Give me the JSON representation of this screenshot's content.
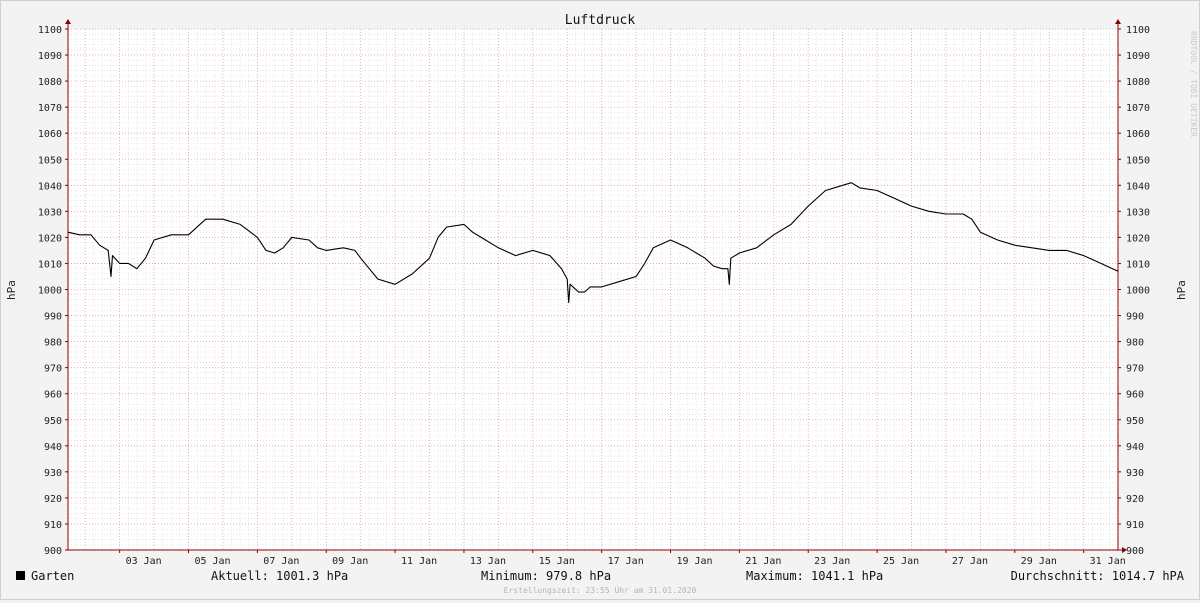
{
  "chart_data": {
    "type": "line",
    "title": "Luftdruck",
    "ylabel": "hPa",
    "ylim": [
      900,
      1100
    ],
    "xlim": [
      "2020-01-01T12:00",
      "2020-01-31T23:55"
    ],
    "grid": true,
    "y_ticks": [
      900,
      910,
      920,
      930,
      940,
      950,
      960,
      970,
      980,
      990,
      1000,
      1010,
      1020,
      1030,
      1040,
      1050,
      1060,
      1070,
      1080,
      1090,
      1100
    ],
    "x_ticks": [
      {
        "date": "2020-01-03",
        "label": "03 Jan"
      },
      {
        "date": "2020-01-05",
        "label": "05 Jan"
      },
      {
        "date": "2020-01-07",
        "label": "07 Jan"
      },
      {
        "date": "2020-01-09",
        "label": "09 Jan"
      },
      {
        "date": "2020-01-11",
        "label": "11 Jan"
      },
      {
        "date": "2020-01-13",
        "label": "13 Jan"
      },
      {
        "date": "2020-01-15",
        "label": "15 Jan"
      },
      {
        "date": "2020-01-17",
        "label": "17 Jan"
      },
      {
        "date": "2020-01-19",
        "label": "19 Jan"
      },
      {
        "date": "2020-01-21",
        "label": "21 Jan"
      },
      {
        "date": "2020-01-23",
        "label": "23 Jan"
      },
      {
        "date": "2020-01-25",
        "label": "25 Jan"
      },
      {
        "date": "2020-01-27",
        "label": "27 Jan"
      },
      {
        "date": "2020-01-29",
        "label": "29 Jan"
      },
      {
        "date": "2020-01-31",
        "label": "31 Jan"
      }
    ],
    "series": [
      {
        "name": "Garten",
        "color": "#000000",
        "points": [
          {
            "x": "2020-01-01T12:00",
            "y": 1022
          },
          {
            "x": "2020-01-01T20:00",
            "y": 1021
          },
          {
            "x": "2020-01-02T04:00",
            "y": 1021
          },
          {
            "x": "2020-01-02T10:00",
            "y": 1017
          },
          {
            "x": "2020-01-02T16:00",
            "y": 1015
          },
          {
            "x": "2020-01-02T18:00",
            "y": 1005
          },
          {
            "x": "2020-01-02T19:00",
            "y": 1013
          },
          {
            "x": "2020-01-03T00:00",
            "y": 1010
          },
          {
            "x": "2020-01-03T06:00",
            "y": 1010
          },
          {
            "x": "2020-01-03T12:00",
            "y": 1008
          },
          {
            "x": "2020-01-03T18:00",
            "y": 1012
          },
          {
            "x": "2020-01-04T00:00",
            "y": 1019
          },
          {
            "x": "2020-01-04T12:00",
            "y": 1021
          },
          {
            "x": "2020-01-05T00:00",
            "y": 1021
          },
          {
            "x": "2020-01-05T12:00",
            "y": 1027
          },
          {
            "x": "2020-01-06T00:00",
            "y": 1027
          },
          {
            "x": "2020-01-06T12:00",
            "y": 1025
          },
          {
            "x": "2020-01-07T00:00",
            "y": 1020
          },
          {
            "x": "2020-01-07T06:00",
            "y": 1015
          },
          {
            "x": "2020-01-07T12:00",
            "y": 1014
          },
          {
            "x": "2020-01-07T18:00",
            "y": 1016
          },
          {
            "x": "2020-01-08T00:00",
            "y": 1020
          },
          {
            "x": "2020-01-08T12:00",
            "y": 1019
          },
          {
            "x": "2020-01-08T18:00",
            "y": 1016
          },
          {
            "x": "2020-01-09T00:00",
            "y": 1015
          },
          {
            "x": "2020-01-09T12:00",
            "y": 1016
          },
          {
            "x": "2020-01-09T20:00",
            "y": 1015
          },
          {
            "x": "2020-01-10T00:00",
            "y": 1012
          },
          {
            "x": "2020-01-10T06:00",
            "y": 1008
          },
          {
            "x": "2020-01-10T12:00",
            "y": 1004
          },
          {
            "x": "2020-01-11T00:00",
            "y": 1002
          },
          {
            "x": "2020-01-11T12:00",
            "y": 1006
          },
          {
            "x": "2020-01-12T00:00",
            "y": 1012
          },
          {
            "x": "2020-01-12T06:00",
            "y": 1020
          },
          {
            "x": "2020-01-12T12:00",
            "y": 1024
          },
          {
            "x": "2020-01-13T00:00",
            "y": 1025
          },
          {
            "x": "2020-01-13T06:00",
            "y": 1022
          },
          {
            "x": "2020-01-13T12:00",
            "y": 1020
          },
          {
            "x": "2020-01-14T00:00",
            "y": 1016
          },
          {
            "x": "2020-01-14T12:00",
            "y": 1013
          },
          {
            "x": "2020-01-15T00:00",
            "y": 1015
          },
          {
            "x": "2020-01-15T12:00",
            "y": 1013
          },
          {
            "x": "2020-01-15T20:00",
            "y": 1008
          },
          {
            "x": "2020-01-16T00:00",
            "y": 1004
          },
          {
            "x": "2020-01-16T01:00",
            "y": 995
          },
          {
            "x": "2020-01-16T02:00",
            "y": 1002
          },
          {
            "x": "2020-01-16T08:00",
            "y": 999
          },
          {
            "x": "2020-01-16T12:00",
            "y": 999
          },
          {
            "x": "2020-01-16T16:00",
            "y": 1001
          },
          {
            "x": "2020-01-17T00:00",
            "y": 1001
          },
          {
            "x": "2020-01-17T12:00",
            "y": 1003
          },
          {
            "x": "2020-01-18T00:00",
            "y": 1005
          },
          {
            "x": "2020-01-18T06:00",
            "y": 1010
          },
          {
            "x": "2020-01-18T12:00",
            "y": 1016
          },
          {
            "x": "2020-01-19T00:00",
            "y": 1019
          },
          {
            "x": "2020-01-19T12:00",
            "y": 1016
          },
          {
            "x": "2020-01-20T00:00",
            "y": 1012
          },
          {
            "x": "2020-01-20T06:00",
            "y": 1009
          },
          {
            "x": "2020-01-20T12:00",
            "y": 1008
          },
          {
            "x": "2020-01-20T16:00",
            "y": 1008
          },
          {
            "x": "2020-01-20T17:00",
            "y": 1002
          },
          {
            "x": "2020-01-20T18:00",
            "y": 1012
          },
          {
            "x": "2020-01-21T00:00",
            "y": 1014
          },
          {
            "x": "2020-01-21T12:00",
            "y": 1016
          },
          {
            "x": "2020-01-22T00:00",
            "y": 1021
          },
          {
            "x": "2020-01-22T12:00",
            "y": 1025
          },
          {
            "x": "2020-01-23T00:00",
            "y": 1032
          },
          {
            "x": "2020-01-23T12:00",
            "y": 1038
          },
          {
            "x": "2020-01-24T00:00",
            "y": 1040
          },
          {
            "x": "2020-01-24T06:00",
            "y": 1041
          },
          {
            "x": "2020-01-24T12:00",
            "y": 1039
          },
          {
            "x": "2020-01-25T00:00",
            "y": 1038
          },
          {
            "x": "2020-01-25T12:00",
            "y": 1035
          },
          {
            "x": "2020-01-26T00:00",
            "y": 1032
          },
          {
            "x": "2020-01-26T12:00",
            "y": 1030
          },
          {
            "x": "2020-01-27T00:00",
            "y": 1029
          },
          {
            "x": "2020-01-27T12:00",
            "y": 1029
          },
          {
            "x": "2020-01-27T18:00",
            "y": 1027
          },
          {
            "x": "2020-01-28T00:00",
            "y": 1022
          },
          {
            "x": "2020-01-28T12:00",
            "y": 1019
          },
          {
            "x": "2020-01-29T00:00",
            "y": 1017
          },
          {
            "x": "2020-01-29T12:00",
            "y": 1016
          },
          {
            "x": "2020-01-30T00:00",
            "y": 1015
          },
          {
            "x": "2020-01-30T12:00",
            "y": 1015
          },
          {
            "x": "2020-01-31T00:00",
            "y": 1013
          },
          {
            "x": "2020-01-31T12:00",
            "y": 1010
          },
          {
            "x": "2020-01-31T23:55",
            "y": 1007
          }
        ]
      }
    ]
  },
  "legend": {
    "label": "Garten",
    "color": "#000000"
  },
  "stats": {
    "current": "Aktuell: 1001.3 hPa",
    "minimum": "Minimum: 979.8 hPa",
    "maximum": "Maximum: 1041.1 hPa",
    "average": "Durchschnitt: 1014.7 hPA"
  },
  "footer": "Erstellungszeit: 23:55 Uhr am 31.01.2020",
  "watermark": "RRDTOOL / TOBI OETIKER",
  "colors": {
    "background": "#f3f3f3",
    "plot": "#ffffff",
    "major_grid": "#e8a0a0",
    "minor_grid": "#d6d6d6",
    "axis": "#8c0000"
  }
}
